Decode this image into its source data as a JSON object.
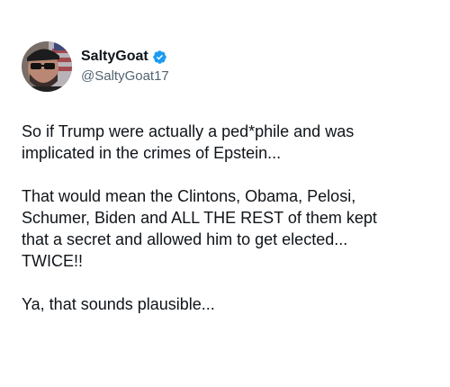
{
  "user": {
    "display_name": "SaltyGoat",
    "handle": "@SaltyGoat17",
    "avatar_icon": "avatar-photo-icon",
    "verified_icon": "verified-badge-icon",
    "verified_color": "#1d9bf0"
  },
  "tweet": {
    "paragraphs": [
      {
        "lines": [
          "So if Trump were actually a ped*phile and was",
          "implicated in the crimes of Epstein..."
        ]
      },
      {
        "lines": [
          "That would mean the Clintons, Obama, Pelosi,",
          "Schumer, Biden and ALL THE REST of them kept",
          "that a secret and allowed him to get elected...",
          "TWICE!!"
        ]
      },
      {
        "lines": [
          "Ya, that sounds plausible..."
        ]
      }
    ]
  }
}
